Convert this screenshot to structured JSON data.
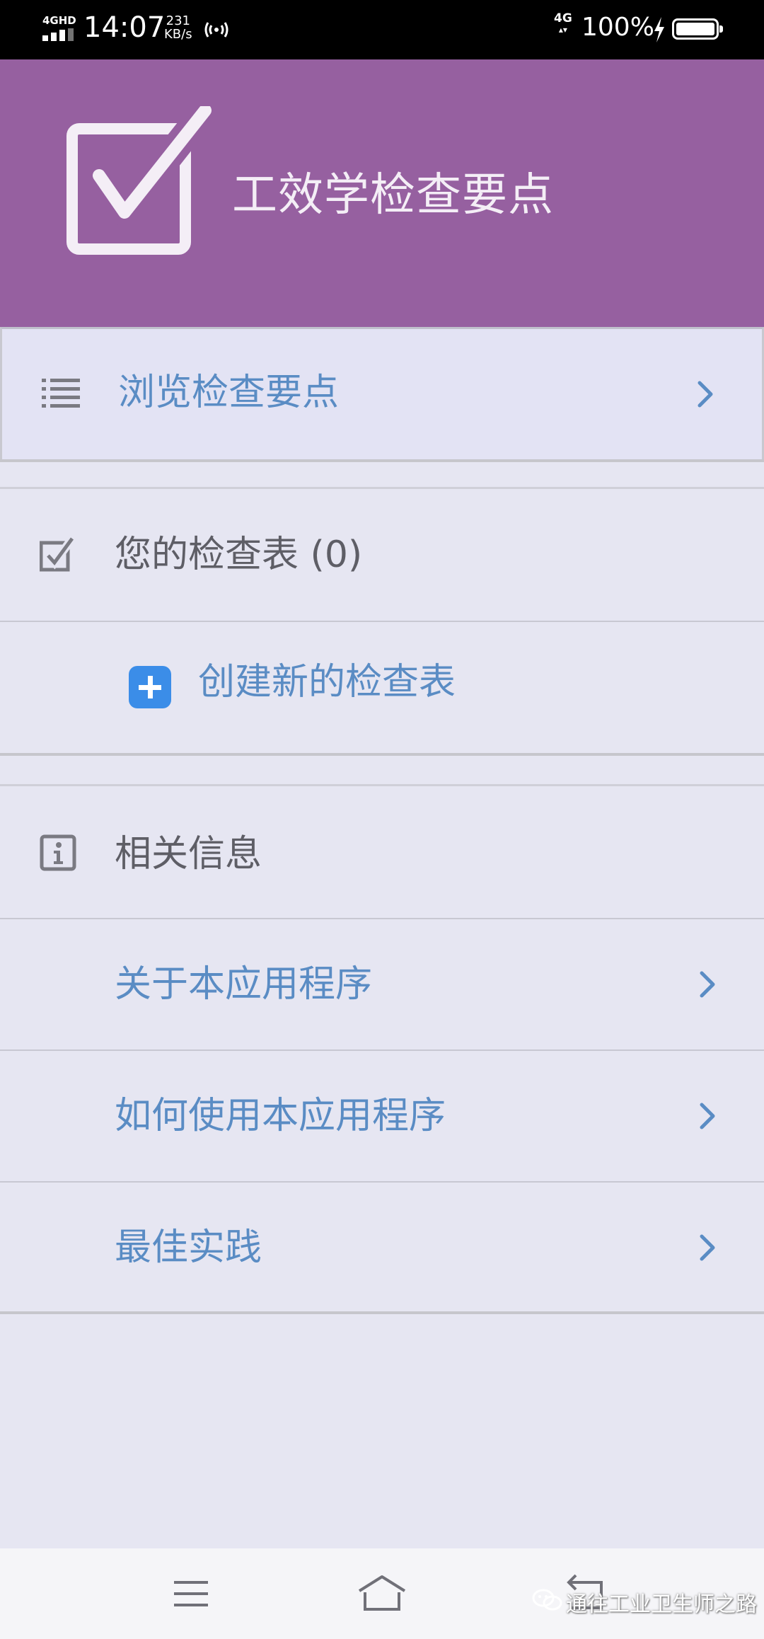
{
  "status_bar": {
    "network_tag": "4GHD",
    "time": "14:07",
    "speed_value": "231",
    "speed_unit": "KB/s",
    "network_right": "4G",
    "battery_percent": "100%",
    "battery_level": 1.0
  },
  "header": {
    "title": "工效学检查要点",
    "logo_icon": "checkbox-check-icon",
    "background_color": "#9660a0"
  },
  "browse": {
    "label": "浏览检查要点",
    "icon": "list-icon"
  },
  "checklists": {
    "label": "您的检查表 (0)",
    "icon": "checked-box-icon",
    "create_label": "创建新的检查表",
    "create_icon": "plus-icon",
    "accent_color": "#3b8de8"
  },
  "info": {
    "label": "相关信息",
    "icon": "info-icon",
    "items": [
      {
        "label": "关于本应用程序"
      },
      {
        "label": "如何使用本应用程序"
      },
      {
        "label": "最佳实践"
      }
    ]
  },
  "nav_bar": {
    "menu_icon": "menu-icon",
    "home_icon": "home-icon",
    "back_icon": "back-icon"
  },
  "watermark": {
    "text": "通往工业卫生师之路",
    "icon": "wechat-icon"
  },
  "colors": {
    "link": "#5a8cc4",
    "background": "#e6e6f2"
  }
}
